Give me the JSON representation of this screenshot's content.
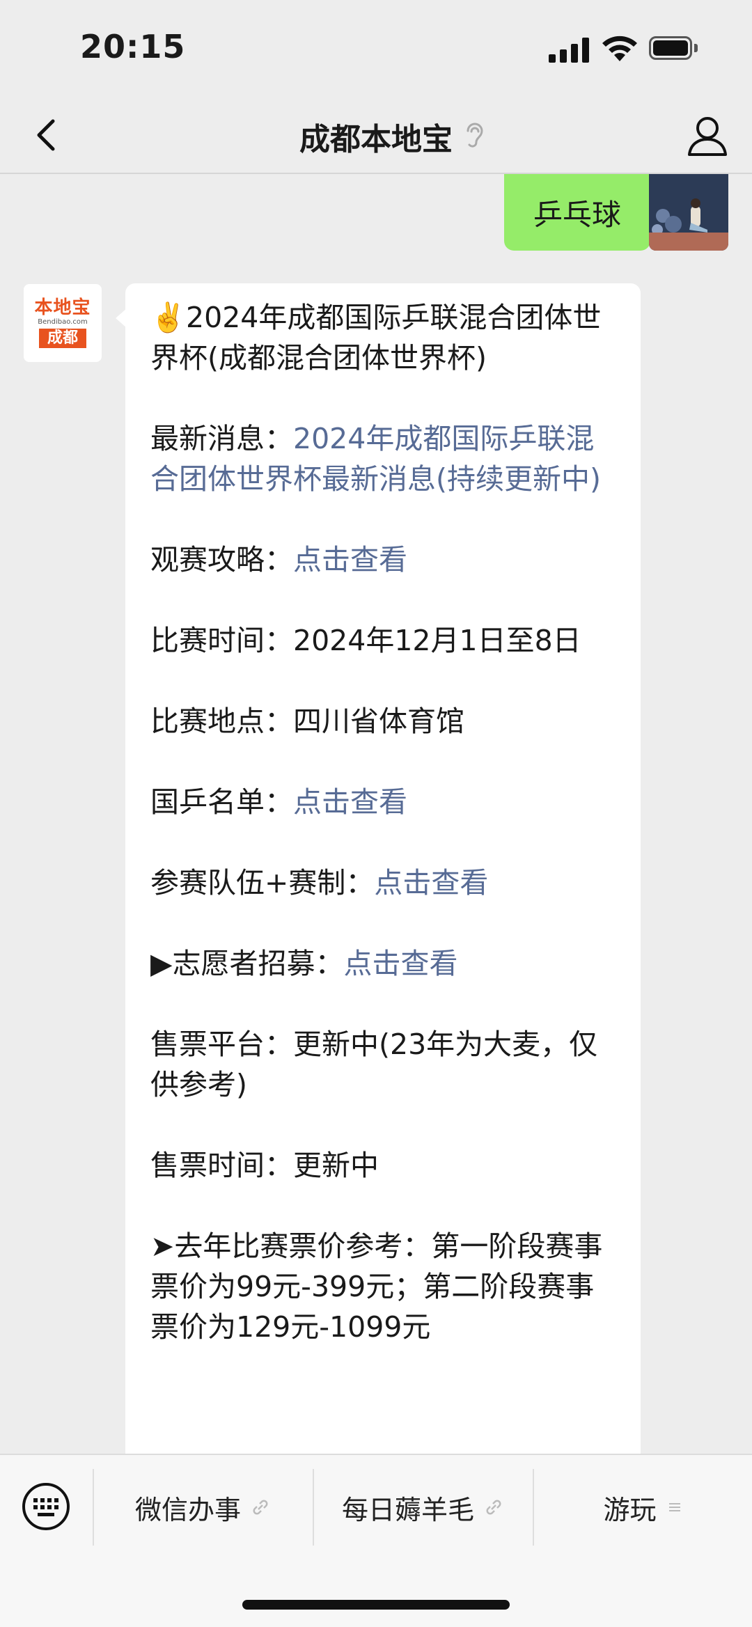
{
  "status": {
    "time": "20:15"
  },
  "nav": {
    "title": "成都本地宝"
  },
  "sent": {
    "text": "乒乓球"
  },
  "bot": {
    "logo_top": "本地宝",
    "logo_mid": "Bendibao.com",
    "logo_bottom": "成都"
  },
  "message": {
    "title": "✌️2024年成都国际乒联混合团体世界杯(成都混合团体世界杯)",
    "news_label": "最新消息：",
    "news_link": "2024年成都国际乒联混合团体世界杯最新消息(持续更新中)",
    "guide_label": "观赛攻略：",
    "guide_link": "点击查看",
    "time_text": "比赛时间：2024年12月1日至8日",
    "venue_text": "比赛地点：四川省体育馆",
    "roster_label": "国乒名单：",
    "roster_link": "点击查看",
    "teams_label": "参赛队伍+赛制：",
    "teams_link": "点击查看",
    "volunteer_label": "▶志愿者招募：",
    "volunteer_link": "点击查看",
    "platform_text": "售票平台：更新中(23年为大麦，仅供参考)",
    "sale_time_text": "售票时间：更新中",
    "price_text": "➤去年比赛票价参考：第一阶段赛事票价为99元-399元；第二阶段赛事票价为129元-1099元"
  },
  "menu": {
    "item1": "微信办事",
    "item2": "每日薅羊毛",
    "item3": "游玩"
  },
  "colors": {
    "link": "#576b95",
    "sent_bubble": "#95ec69",
    "logo": "#e8531f"
  }
}
